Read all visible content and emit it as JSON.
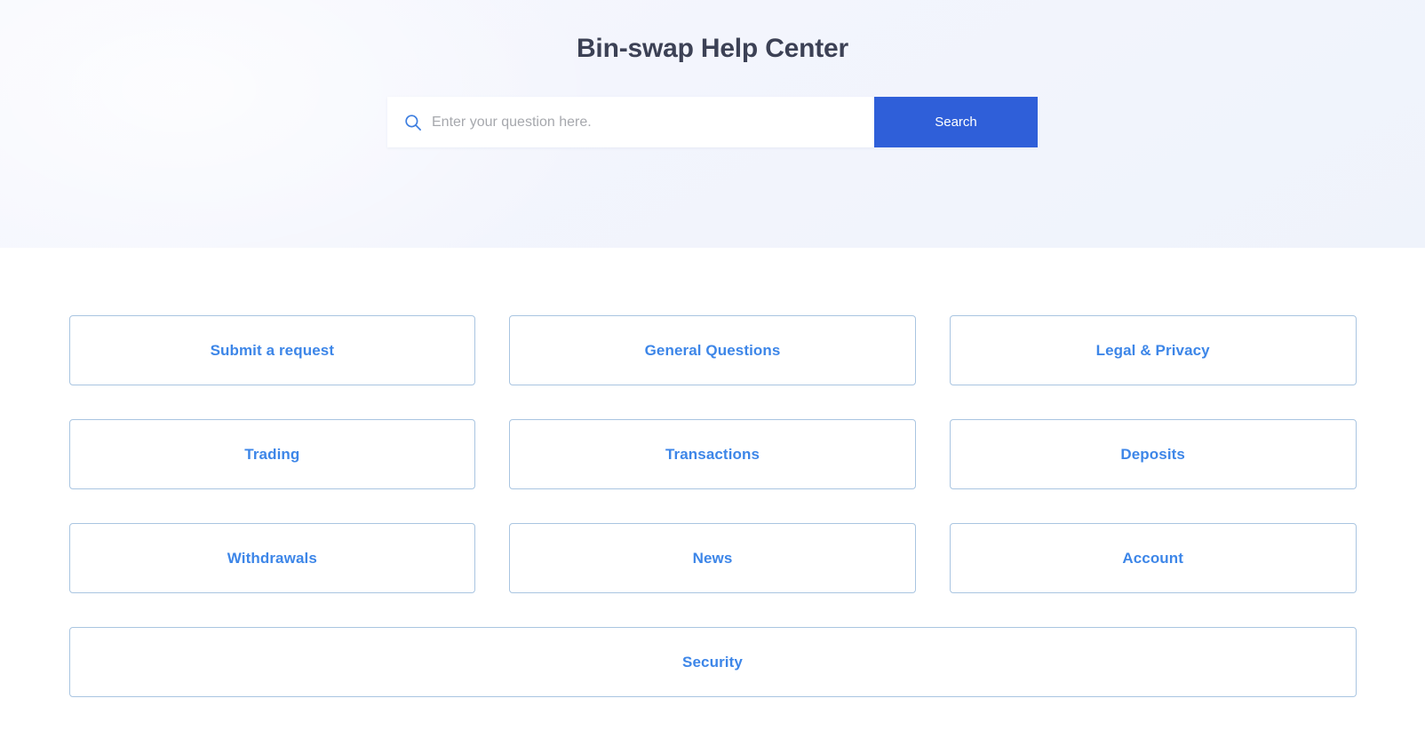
{
  "hero": {
    "title": "Bin-swap Help Center",
    "background_from": "#f6f7fe",
    "background_to": "#eff3fb"
  },
  "search": {
    "icon": "search-icon",
    "placeholder": "Enter your question here.",
    "value": "",
    "button_label": "Search",
    "button_color": "#2f5fd9"
  },
  "categories": {
    "link_color": "#3d86e8",
    "border_color": "#a9c5e1",
    "rows": [
      [
        {
          "label": "Submit a request"
        },
        {
          "label": "General Questions"
        },
        {
          "label": "Legal & Privacy"
        }
      ],
      [
        {
          "label": "Trading"
        },
        {
          "label": "Transactions"
        },
        {
          "label": "Deposits"
        }
      ],
      [
        {
          "label": "Withdrawals"
        },
        {
          "label": "News"
        },
        {
          "label": "Account"
        }
      ],
      [
        {
          "label": "Security"
        }
      ]
    ]
  }
}
